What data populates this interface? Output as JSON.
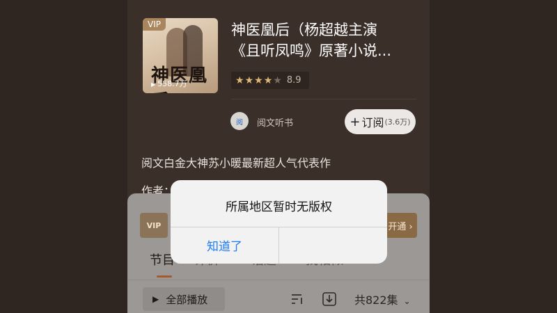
{
  "album": {
    "cover_badge": "VIP",
    "cover_calligraphy": "神医凰后",
    "cover_plays": "558.7万",
    "title_line1": "神医凰后（杨超越主演",
    "title_line2": "《且听凤鸣》原著小说...",
    "rating_stars": 4,
    "rating_score": "8.9"
  },
  "publisher": {
    "logo_text": "阅",
    "name": "阅文听书"
  },
  "subscribe": {
    "label": "订阅",
    "count": "(3.6万)"
  },
  "intro": {
    "description": "阅文白金大神苏小暖最新超人气代表作",
    "author_prefix": "作者："
  },
  "vip_bar": {
    "badge": "VIP",
    "action": "开通 ›"
  },
  "tabs": [
    {
      "label": "节目"
    },
    {
      "label": "评价"
    },
    {
      "label": "话题"
    },
    {
      "label": "找相似"
    }
  ],
  "toolbar": {
    "play_all": "全部播放",
    "episodes": "共822集"
  },
  "alert": {
    "message": "所属地区暂时无版权",
    "confirm": "知道了"
  }
}
